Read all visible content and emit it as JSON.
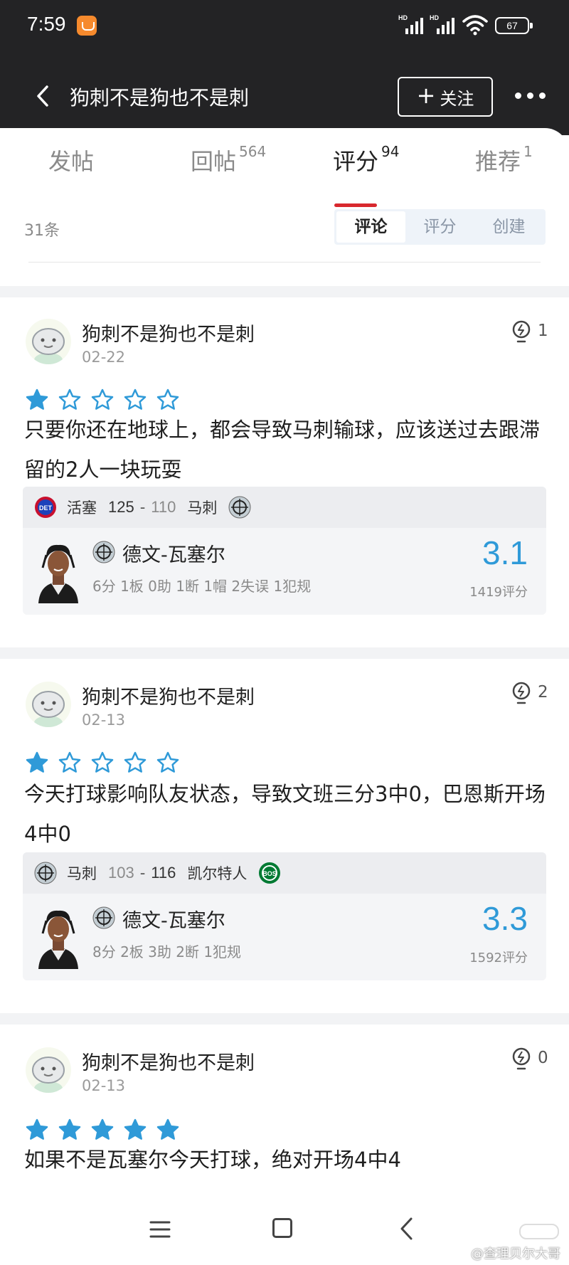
{
  "status_bar": {
    "time": "7:59",
    "network_1": "HD",
    "network_2": "HD",
    "battery": "67"
  },
  "header": {
    "title": "狗刺不是狗也不是刺",
    "follow_plus": "+",
    "follow_label": "关注"
  },
  "tabs": [
    {
      "label": "发帖",
      "count": ""
    },
    {
      "label": "回帖",
      "count": "564"
    },
    {
      "label": "评分",
      "count": "94"
    },
    {
      "label": "推荐",
      "count": "1"
    }
  ],
  "active_tab": "评分",
  "list_count": "31条",
  "sort_options": [
    "评论",
    "评分",
    "创建"
  ],
  "sort_selected": "评论",
  "colors": {
    "accent_red": "#d8282e",
    "star_blue": "#2f9ad8",
    "rating_blue": "#2f9ad8"
  },
  "reviews": [
    {
      "user": "狗刺不是狗也不是刺",
      "date": "02-22",
      "likes": "1",
      "stars": 1,
      "comment": "只要你还在地球上，都会导致马刺输球，应该送过去跟滞留的2人一块玩耍",
      "game": {
        "team1": "活塞",
        "team1_logo": "DET",
        "score1": "125",
        "separator": "-",
        "score2": "110",
        "team2": "马刺",
        "team2_logo": "SAS"
      },
      "player": {
        "team_logo": "SAS",
        "name": "德文-瓦塞尔",
        "stats": "6分 1板 0助 1断 1帽 2失误 1犯规",
        "rating": "3.1",
        "rating_count": "1419评分"
      }
    },
    {
      "user": "狗刺不是狗也不是刺",
      "date": "02-13",
      "likes": "2",
      "stars": 1,
      "comment": "今天打球影响队友状态，导致文班三分3中0，巴恩斯开场4中0",
      "game": {
        "team1": "马刺",
        "team1_logo": "SAS",
        "score1": "103",
        "separator": "-",
        "score2": "116",
        "team2": "凯尔特人",
        "team2_logo": "BOS"
      },
      "player": {
        "team_logo": "SAS",
        "name": "德文-瓦塞尔",
        "stats": "8分 2板 3助 2断 1犯规",
        "rating": "3.3",
        "rating_count": "1592评分"
      }
    },
    {
      "user": "狗刺不是狗也不是刺",
      "date": "02-13",
      "likes": "0",
      "stars": 5,
      "comment": "如果不是瓦塞尔今天打球，绝对开场4中4"
    }
  ],
  "watermark": "@查理贝尔大哥"
}
